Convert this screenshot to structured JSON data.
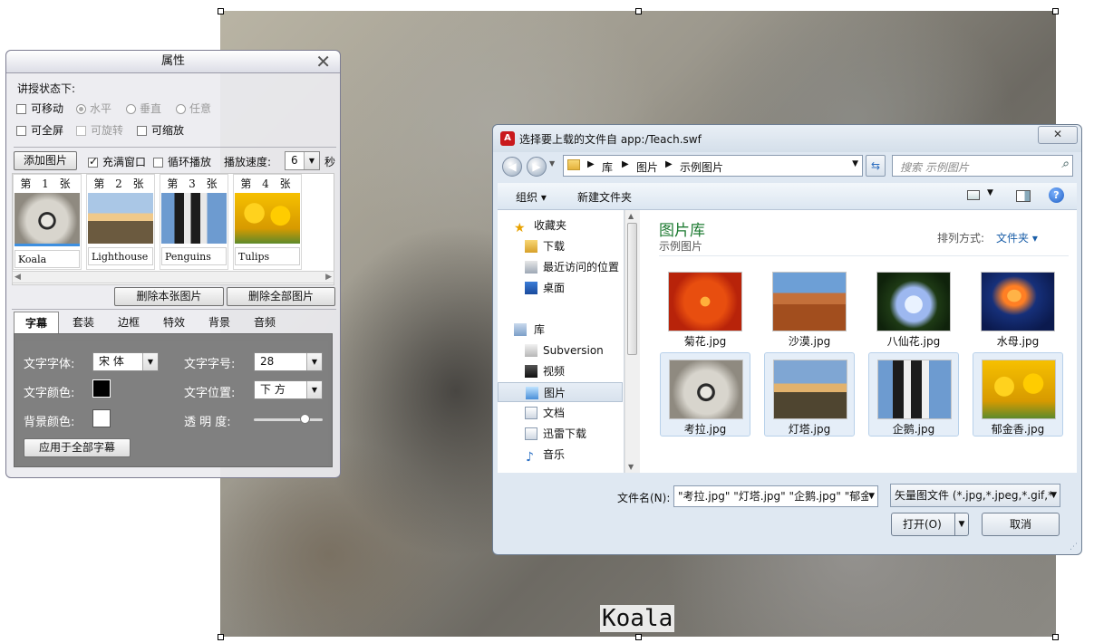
{
  "canvas": {
    "caption": "Koala"
  },
  "panel": {
    "title": "属性",
    "section_label": "讲授状态下:",
    "movable": {
      "label": "可移动",
      "checked": false
    },
    "orientation": [
      {
        "label": "水平",
        "checked": true
      },
      {
        "label": "垂直",
        "checked": false
      },
      {
        "label": "任意",
        "checked": false
      }
    ],
    "fullscreen": {
      "label": "可全屏",
      "checked": false
    },
    "rotatable": {
      "label": "可旋转",
      "checked": false,
      "disabled": true
    },
    "scalable": {
      "label": "可缩放",
      "checked": false
    },
    "add_image_button": "添加图片",
    "fill_window": {
      "label": "充满窗口",
      "checked": true
    },
    "loop_play": {
      "label": "循环播放",
      "checked": false
    },
    "speed_label": "播放速度:",
    "speed_value": "6",
    "speed_unit": "秒",
    "thumbnails": [
      {
        "label": "第 1 张",
        "name": "Koala"
      },
      {
        "label": "第 2 张",
        "name": "Lighthouse"
      },
      {
        "label": "第 3 张",
        "name": "Penguins"
      },
      {
        "label": "第 4 张",
        "name": "Tulips"
      }
    ],
    "delete_current_button": "删除本张图片",
    "delete_all_button": "删除全部图片",
    "tabs": [
      "字幕",
      "套装",
      "边框",
      "特效",
      "背景",
      "音频"
    ],
    "active_tab": "字幕",
    "subtitle": {
      "font_label": "文字字体:",
      "font_value": "宋 体",
      "size_label": "文字字号:",
      "size_value": "28",
      "color_label": "文字颜色:",
      "text_color": "#000000",
      "position_label": "文字位置:",
      "position_value": "下 方",
      "bg_color_label": "背景颜色:",
      "bg_color": "#ffffff",
      "opacity_label": "透 明 度:",
      "opacity_value": 0.85,
      "apply_all_button": "应用于全部字幕"
    }
  },
  "dialog": {
    "title": "选择要上载的文件自 app:/Teach.swf",
    "breadcrumb": [
      "库",
      "图片",
      "示例图片"
    ],
    "search_placeholder": "搜索 示例图片",
    "organize": "组织 ▾",
    "new_folder": "新建文件夹",
    "nav": {
      "favorites": "收藏夹",
      "favorites_items": [
        "下载",
        "最近访问的位置",
        "桌面"
      ],
      "libraries": "库",
      "library_items": [
        "Subversion",
        "视频",
        "图片",
        "文档",
        "迅雷下载",
        "音乐"
      ],
      "selected": "图片"
    },
    "library_title": "图片库",
    "library_subtitle": "示例图片",
    "arrange_label": "排列方式:",
    "arrange_value": "文件夹 ▾",
    "files": [
      {
        "name": "菊花.jpg",
        "selected": false
      },
      {
        "name": "沙漠.jpg",
        "selected": false
      },
      {
        "name": "八仙花.jpg",
        "selected": false
      },
      {
        "name": "水母.jpg",
        "selected": false
      },
      {
        "name": "考拉.jpg",
        "selected": true
      },
      {
        "name": "灯塔.jpg",
        "selected": true
      },
      {
        "name": "企鹅.jpg",
        "selected": true
      },
      {
        "name": "郁金香.jpg",
        "selected": true
      }
    ],
    "filename_label": "文件名(N):",
    "filename_value": "\"考拉.jpg\" \"灯塔.jpg\" \"企鹅.jpg\" \"郁金",
    "filetype_value": "矢量图文件 (*.jpg,*.jpeg,*.gif,*",
    "open_button": "打开(O)",
    "cancel_button": "取消",
    "colors": {
      "accent": "#1e7b32",
      "link": "#1a5ea8"
    }
  }
}
